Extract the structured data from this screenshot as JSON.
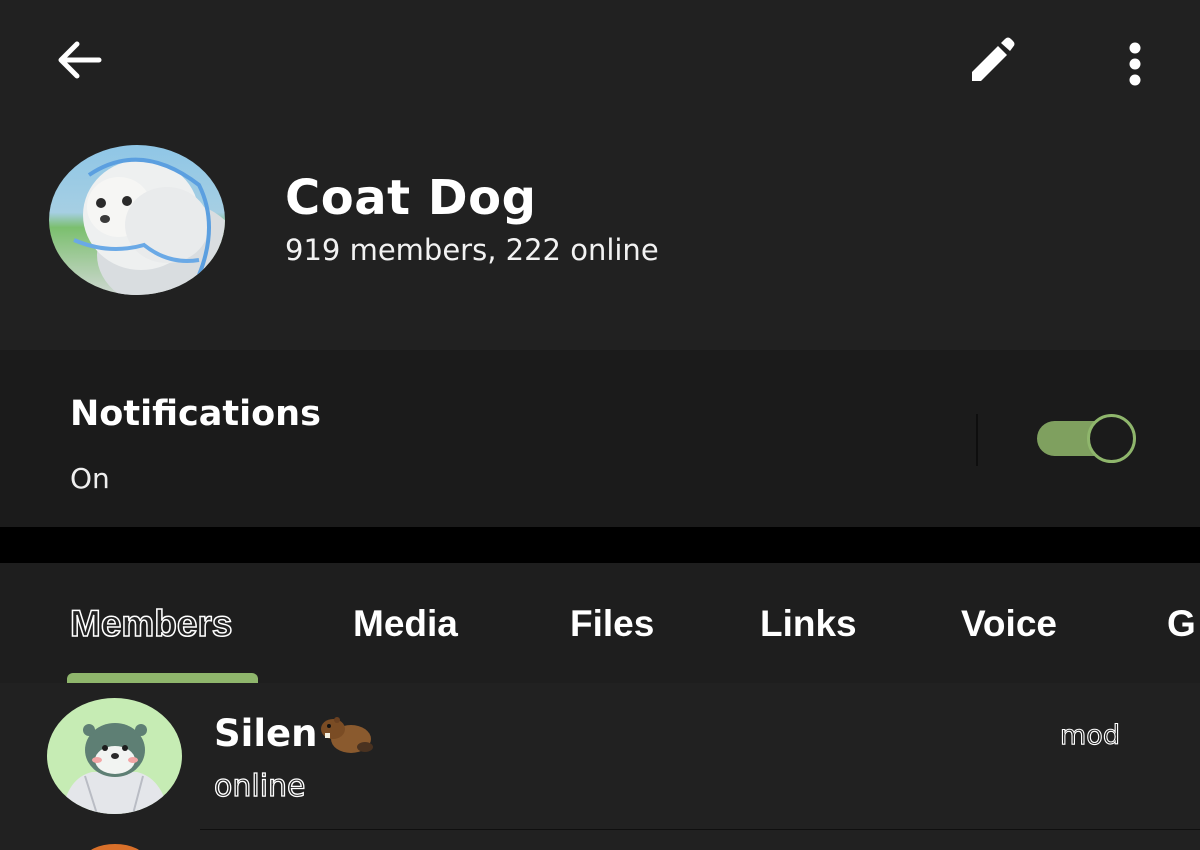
{
  "header": {
    "back_icon": "arrow-left-icon",
    "edit_icon": "pencil-icon",
    "more_icon": "more-vertical-icon",
    "title": "Coat Dog",
    "subtitle": "919 members, 222 online"
  },
  "notifications": {
    "label": "Notifications",
    "value": "On",
    "enabled": true
  },
  "tabs": [
    {
      "label": "Members",
      "active": true
    },
    {
      "label": "Media",
      "active": false
    },
    {
      "label": "Files",
      "active": false
    },
    {
      "label": "Links",
      "active": false
    },
    {
      "label": "Voice",
      "active": false
    },
    {
      "label": "G",
      "active": false
    }
  ],
  "members": [
    {
      "name": "Silen",
      "emoji": "beaver-icon",
      "status": "online",
      "role": "mod"
    }
  ],
  "colors": {
    "background": "#212121",
    "section": "#1b1b1b",
    "accent": "#8fb66c",
    "toggle_track": "#7fa05f"
  }
}
